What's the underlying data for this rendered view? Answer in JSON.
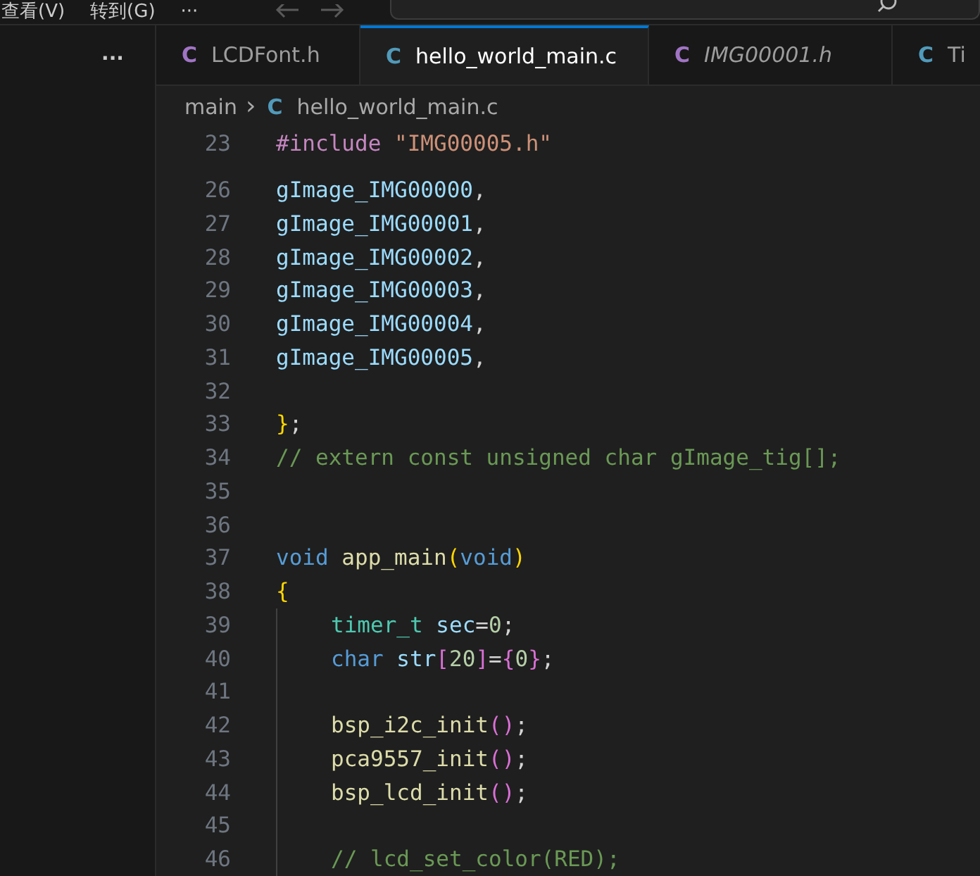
{
  "menu": [
    "查看(V)",
    "转到(G)",
    "···"
  ],
  "sidebar": {
    "more": "···"
  },
  "tabs": [
    {
      "label": "LCDFont.h",
      "icon": "C",
      "color": "#a074c4",
      "selected": false,
      "preview": false
    },
    {
      "label": "hello_world_main.c",
      "icon": "C",
      "color": "#519aba",
      "selected": true,
      "preview": false
    },
    {
      "label": "IMG00001.h",
      "icon": "C",
      "color": "#a074c4",
      "selected": false,
      "preview": true
    },
    {
      "label": "Ti",
      "icon": "C",
      "color": "#519aba",
      "selected": false,
      "preview": false
    }
  ],
  "breadcrumb": {
    "folder": "main",
    "separator": "›",
    "icon": "C",
    "file": "hello_world_main.c"
  },
  "code": [
    {
      "number": "23",
      "indent": false,
      "tokens": [
        {
          "text": "#include ",
          "kind": "pre"
        },
        {
          "text": "\"IMG00005.h\"",
          "kind": "str"
        }
      ]
    },
    {
      "number": "26",
      "indent": false,
      "tokens": [
        {
          "text": "gImage_IMG00000",
          "kind": "var"
        },
        {
          "text": ",",
          "kind": "plain"
        }
      ]
    },
    {
      "number": "27",
      "indent": false,
      "tokens": [
        {
          "text": "gImage_IMG00001",
          "kind": "var"
        },
        {
          "text": ",",
          "kind": "plain"
        }
      ]
    },
    {
      "number": "28",
      "indent": false,
      "tokens": [
        {
          "text": "gImage_IMG00002",
          "kind": "var"
        },
        {
          "text": ",",
          "kind": "plain"
        }
      ]
    },
    {
      "number": "29",
      "indent": false,
      "tokens": [
        {
          "text": "gImage_IMG00003",
          "kind": "var"
        },
        {
          "text": ",",
          "kind": "plain"
        }
      ]
    },
    {
      "number": "30",
      "indent": false,
      "tokens": [
        {
          "text": "gImage_IMG00004",
          "kind": "var"
        },
        {
          "text": ",",
          "kind": "plain"
        }
      ]
    },
    {
      "number": "31",
      "indent": false,
      "tokens": [
        {
          "text": "gImage_IMG00005",
          "kind": "var"
        },
        {
          "text": ",",
          "kind": "plain"
        }
      ]
    },
    {
      "number": "32",
      "indent": false
    },
    {
      "number": "33",
      "indent": false,
      "tokens": [
        {
          "text": "}",
          "kind": "br1"
        },
        {
          "text": ";",
          "kind": "plain"
        }
      ]
    },
    {
      "number": "34",
      "indent": false,
      "tokens": [
        {
          "text": "// extern const unsigned char gImage_tig[];",
          "kind": "cmt"
        }
      ]
    },
    {
      "number": "35",
      "indent": false
    },
    {
      "number": "36",
      "indent": false
    },
    {
      "number": "37",
      "indent": false,
      "tokens": [
        {
          "text": "void ",
          "kind": "kw"
        },
        {
          "text": "app_main",
          "kind": "fn"
        },
        {
          "text": "(",
          "kind": "br1"
        },
        {
          "text": "void",
          "kind": "kw"
        },
        {
          "text": ")",
          "kind": "br1"
        }
      ]
    },
    {
      "number": "38",
      "indent": false,
      "tokens": [
        {
          "text": "{",
          "kind": "br1"
        }
      ]
    },
    {
      "number": "39",
      "indent": true,
      "tokens": [
        {
          "text": "timer_t ",
          "kind": "type"
        },
        {
          "text": "sec",
          "kind": "var"
        },
        {
          "text": "=",
          "kind": "plain"
        },
        {
          "text": "0",
          "kind": "num"
        },
        {
          "text": ";",
          "kind": "plain"
        }
      ]
    },
    {
      "number": "40",
      "indent": true,
      "tokens": [
        {
          "text": "char ",
          "kind": "kw"
        },
        {
          "text": "str",
          "kind": "var"
        },
        {
          "text": "[",
          "kind": "br2"
        },
        {
          "text": "20",
          "kind": "num"
        },
        {
          "text": "]",
          "kind": "br2"
        },
        {
          "text": "=",
          "kind": "plain"
        },
        {
          "text": "{",
          "kind": "br2"
        },
        {
          "text": "0",
          "kind": "num"
        },
        {
          "text": "}",
          "kind": "br2"
        },
        {
          "text": ";",
          "kind": "plain"
        }
      ]
    },
    {
      "number": "41",
      "indent": true
    },
    {
      "number": "42",
      "indent": true,
      "tokens": [
        {
          "text": "bsp_i2c_init",
          "kind": "fn"
        },
        {
          "text": "()",
          "kind": "br2"
        },
        {
          "text": ";",
          "kind": "plain"
        }
      ]
    },
    {
      "number": "43",
      "indent": true,
      "tokens": [
        {
          "text": "pca9557_init",
          "kind": "fn"
        },
        {
          "text": "()",
          "kind": "br2"
        },
        {
          "text": ";",
          "kind": "plain"
        }
      ]
    },
    {
      "number": "44",
      "indent": true,
      "tokens": [
        {
          "text": "bsp_lcd_init",
          "kind": "fn"
        },
        {
          "text": "()",
          "kind": "br2"
        },
        {
          "text": ";",
          "kind": "plain"
        }
      ]
    },
    {
      "number": "45",
      "indent": true
    },
    {
      "number": "46",
      "indent": true,
      "tokens": [
        {
          "text": "// lcd_set_color(RED);",
          "kind": "cmt"
        }
      ]
    }
  ]
}
